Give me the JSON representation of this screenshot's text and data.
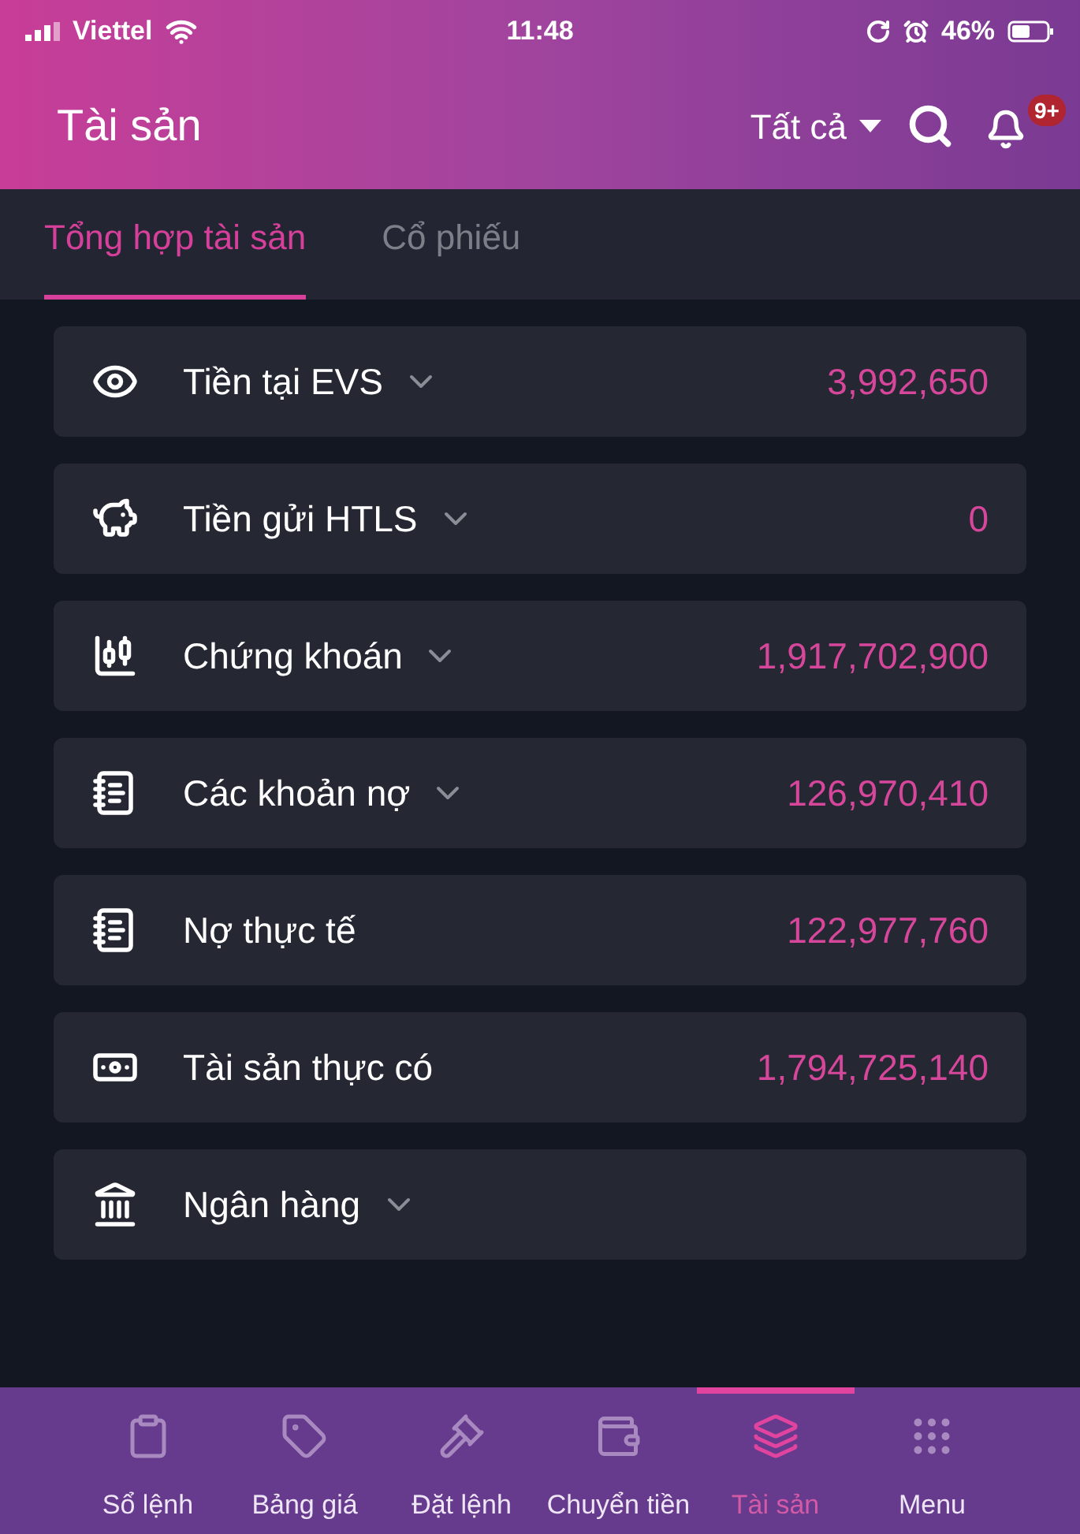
{
  "status_bar": {
    "carrier": "Viettel",
    "time": "11:48",
    "battery": "46%"
  },
  "header": {
    "title": "Tài sản",
    "filter": "Tất cả",
    "notification_badge": "9+"
  },
  "tabs": [
    {
      "label": "Tổng hợp tài sản",
      "selected": true
    },
    {
      "label": "Cổ phiếu",
      "selected": false
    }
  ],
  "assets": [
    {
      "kind": "eye",
      "label": "Tiền tại EVS",
      "expandable": true,
      "value": "3,992,650"
    },
    {
      "kind": "piggy",
      "label": "Tiền gửi HTLS",
      "expandable": true,
      "value": "0"
    },
    {
      "kind": "candles",
      "label": "Chứng khoán",
      "expandable": true,
      "value": "1,917,702,900"
    },
    {
      "kind": "book",
      "label": "Các khoản nợ",
      "expandable": true,
      "value": "126,970,410"
    },
    {
      "kind": "book",
      "label": "Nợ thực tế",
      "expandable": false,
      "value": "122,977,760"
    },
    {
      "kind": "cash",
      "label": "Tài sản thực có",
      "expandable": false,
      "value": "1,794,725,140"
    },
    {
      "kind": "bank",
      "label": "Ngân hàng",
      "expandable": true
    }
  ],
  "bottom_nav": [
    {
      "kind": "clipboard",
      "label": "Sổ lệnh",
      "selected": false
    },
    {
      "kind": "tag",
      "label": "Bảng giá",
      "selected": false
    },
    {
      "kind": "gavel",
      "label": "Đặt lệnh",
      "selected": false
    },
    {
      "kind": "wallet",
      "label": "Chuyển tiền",
      "selected": false
    },
    {
      "kind": "cards",
      "label": "Tài sản",
      "selected": true
    },
    {
      "kind": "grid",
      "label": "Menu",
      "selected": false
    }
  ]
}
